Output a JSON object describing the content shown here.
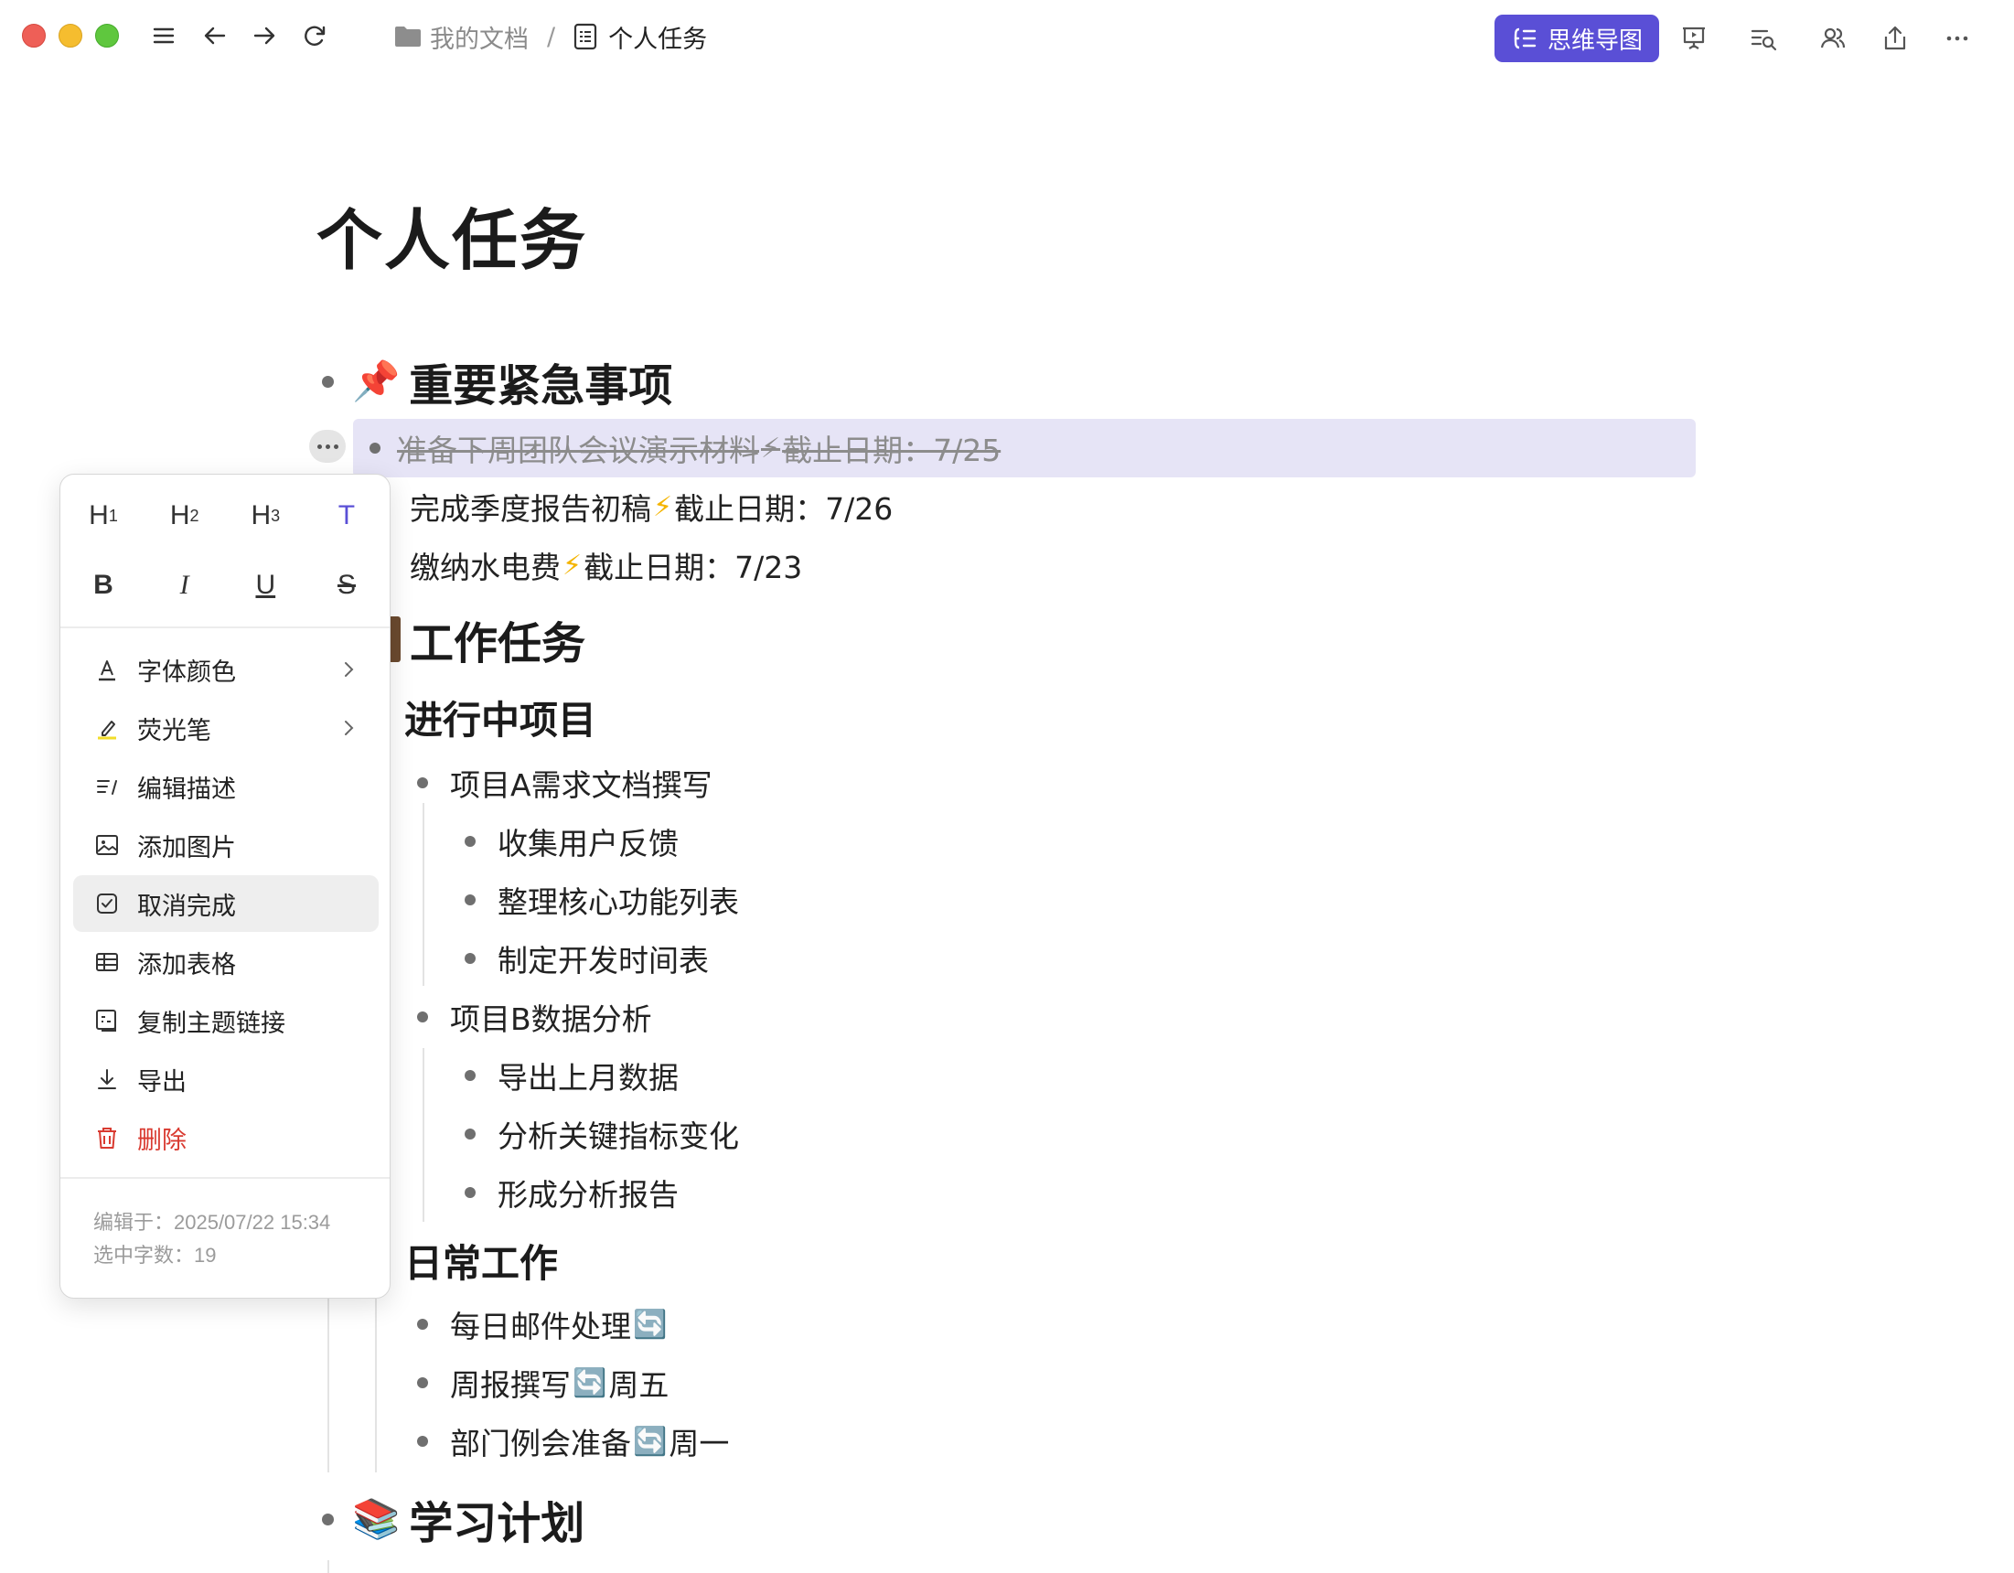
{
  "window": {
    "breadcrumb_folder": "我的文档",
    "breadcrumb_separator": "/",
    "breadcrumb_doc": "个人任务",
    "mindmap_button": "思维导图",
    "accent_color": "#5a4fd6"
  },
  "document": {
    "title": "个人任务",
    "sections": {
      "urgent": {
        "emoji": "📌",
        "heading": "重要紧急事项",
        "items": [
          {
            "text": "准备下周团队会议演示材料",
            "emoji": "⚡",
            "deadline": "截止日期：7/25",
            "completed": true
          },
          {
            "text": "完成季度报告初稿",
            "emoji": "⚡",
            "deadline": "截止日期：7/26",
            "completed": false
          },
          {
            "text": "缴纳水电费",
            "emoji": "⚡",
            "deadline": "截止日期：7/23",
            "completed": false
          }
        ]
      },
      "work": {
        "heading": "工作任务",
        "in_progress": {
          "heading": "进行中项目",
          "project_a": {
            "label": "项目A需求文档撰写",
            "children": [
              "收集用户反馈",
              "整理核心功能列表",
              "制定开发时间表"
            ]
          },
          "project_b": {
            "label": "项目B数据分析",
            "children": [
              "导出上月数据",
              "分析关键指标变化",
              "形成分析报告"
            ]
          }
        },
        "daily": {
          "heading": "日常工作",
          "items": [
            {
              "text": "每日邮件处理",
              "emoji": "🔄",
              "suffix": ""
            },
            {
              "text": "周报撰写",
              "emoji": "🔄",
              "suffix": "周五"
            },
            {
              "text": "部门例会准备",
              "emoji": "🔄",
              "suffix": "周一"
            }
          ]
        }
      },
      "study": {
        "emoji": "📚",
        "heading": "学习计划"
      }
    }
  },
  "context_menu": {
    "format_buttons": {
      "h1": "H",
      "h1_sub": "1",
      "h2": "H",
      "h2_sub": "2",
      "h3": "H",
      "h3_sub": "3",
      "text": "T",
      "bold": "B",
      "italic": "I",
      "underline": "U",
      "strike": "S"
    },
    "items": {
      "font_color": "字体颜色",
      "highlighter": "荧光笔",
      "edit_description": "编辑描述",
      "add_image": "添加图片",
      "uncomplete": "取消完成",
      "add_table": "添加表格",
      "copy_link": "复制主题链接",
      "export": "导出",
      "delete": "删除"
    },
    "edited_at": "编辑于：2025/07/22 15:34",
    "selected_chars": "选中字数：19"
  }
}
